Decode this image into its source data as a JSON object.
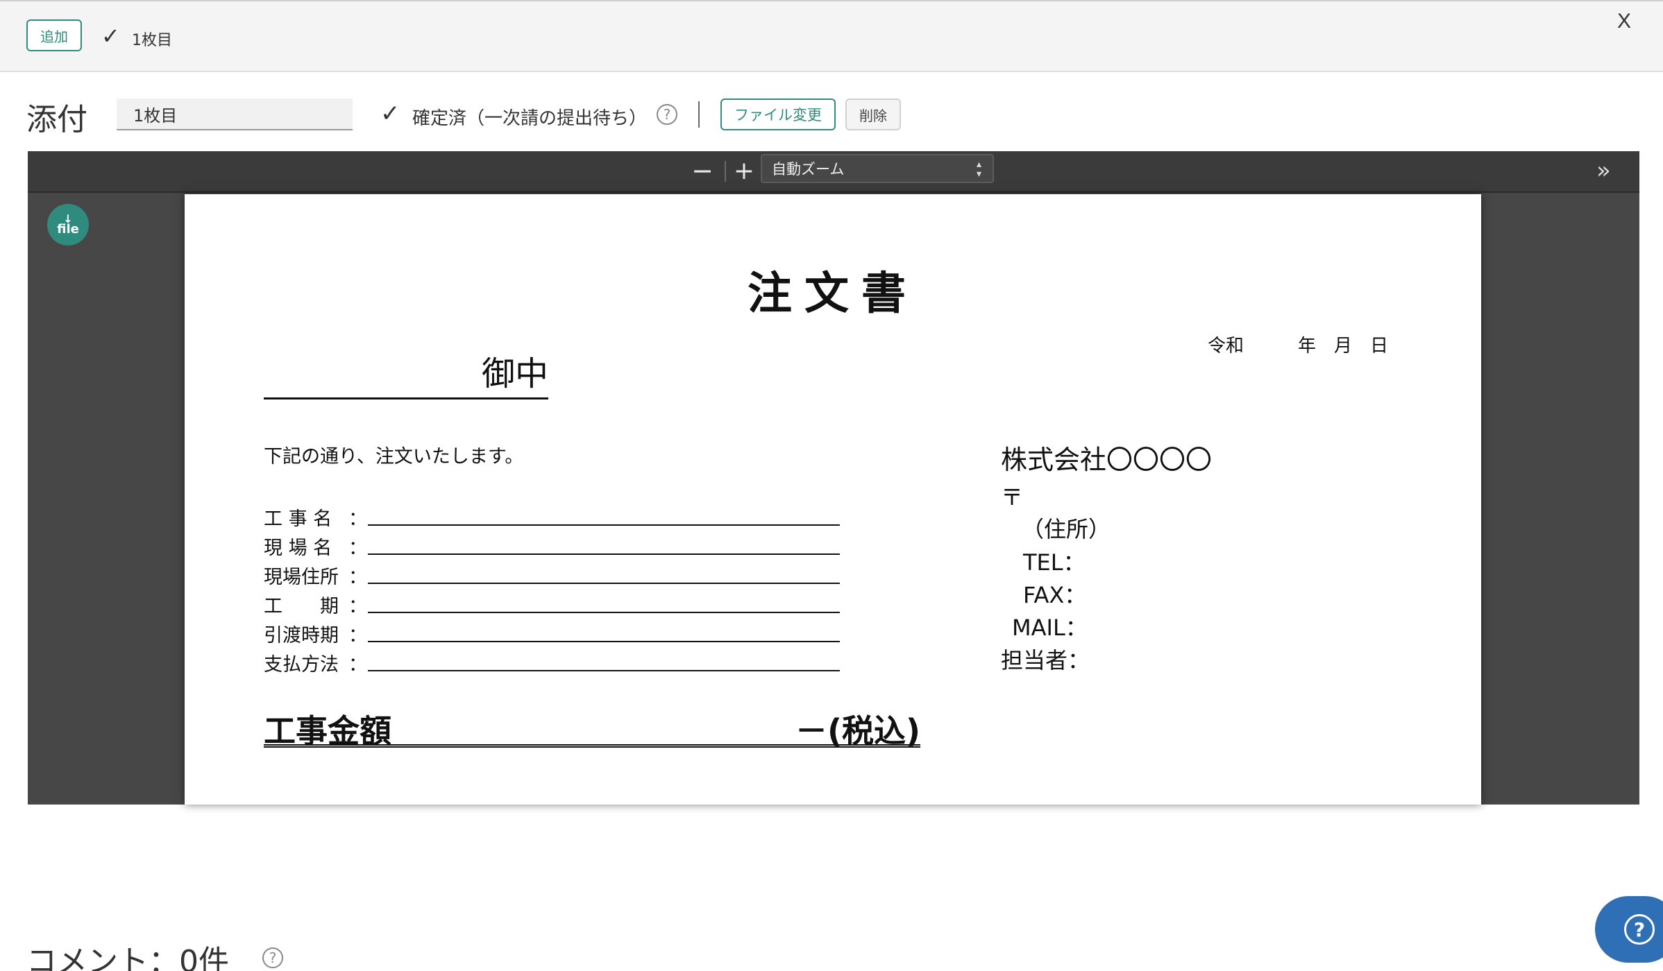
{
  "topbar": {
    "add_label": "追加",
    "check_glyph": "✓",
    "sheet_label": "1枚目",
    "close_label": "X"
  },
  "attachment": {
    "title": "添付",
    "sheet_input_value": "1枚目",
    "status_check_glyph": "✓",
    "status_text": "確定済（一次請の提出待ち）",
    "help_glyph": "?",
    "change_file_label": "ファイル変更",
    "delete_label": "削除"
  },
  "viewer": {
    "zoom_out_label": "−",
    "zoom_in_label": "+",
    "zoom_value": "自動ズーム",
    "sidebar_toggle_glyph": "»",
    "download_label": "file",
    "download_arrow": "↓"
  },
  "document": {
    "title": "注文書",
    "date_line": "令和　　　年　月　日",
    "recipient_suffix": "御中",
    "intro": "下記の通り、注文いたします。",
    "fields": [
      {
        "label": "工 事 名"
      },
      {
        "label": "現 場 名"
      },
      {
        "label": "現場住所"
      },
      {
        "label": "工　　期"
      },
      {
        "label": "引渡時期"
      },
      {
        "label": "支払方法"
      }
    ],
    "colon": "：",
    "total_label": "工事金額",
    "total_suffix": "－(税込)",
    "company_name": "株式会社〇〇〇〇",
    "postal_mark": "〒",
    "address": "（住所）",
    "tel": "TEL：",
    "fax": "FAX：",
    "mail": "MAIL：",
    "contact": "担当者："
  },
  "comments": {
    "count_label": "コメント：0件",
    "help_glyph": "?"
  },
  "help_fab": {
    "glyph": "?"
  },
  "colors": {
    "accent": "#2e8b7d",
    "viewer_bg": "#474747",
    "toolbar_bg": "#3b3b3b",
    "help_fab": "#2e6fb5"
  }
}
